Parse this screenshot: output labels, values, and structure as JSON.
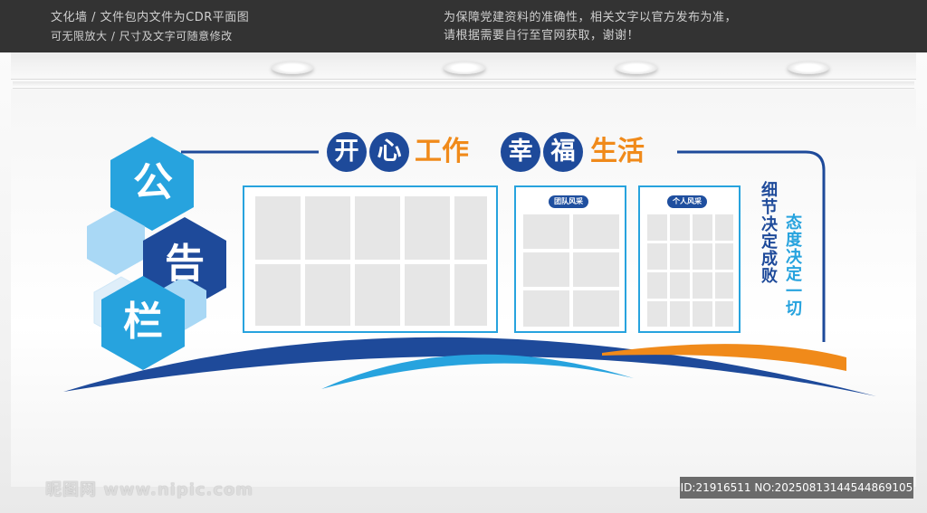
{
  "banner": {
    "left_line1": "文化墙 / 文件包内文件为CDR平面图",
    "left_line2": "可无限放大 / 尺寸及文字可随意修改",
    "right_line1": "为保障党建资料的准确性，相关文字以官方发布为准，",
    "right_line2": "请根据需要自行至官网获取，谢谢！"
  },
  "board": {
    "hex_chars": [
      "公",
      "告",
      "栏"
    ],
    "title_circle_1": [
      "开",
      "心"
    ],
    "title_plain_1": "工作",
    "title_circle_2": [
      "幸",
      "福"
    ],
    "title_plain_2": "生活",
    "tag_team": "团队风采",
    "tag_personal": "个人风采",
    "slogan_1": "细节决定成败",
    "slogan_2": "态度决定一切"
  },
  "colors": {
    "navy": "#1e4a9a",
    "blue": "#27a3de",
    "light_blue": "#a9d8f5",
    "orange": "#f08a1a"
  },
  "watermark": {
    "site": "昵图网 www.nipic.com",
    "id_line": "ID:21916511 NO:20250813144544869105"
  }
}
